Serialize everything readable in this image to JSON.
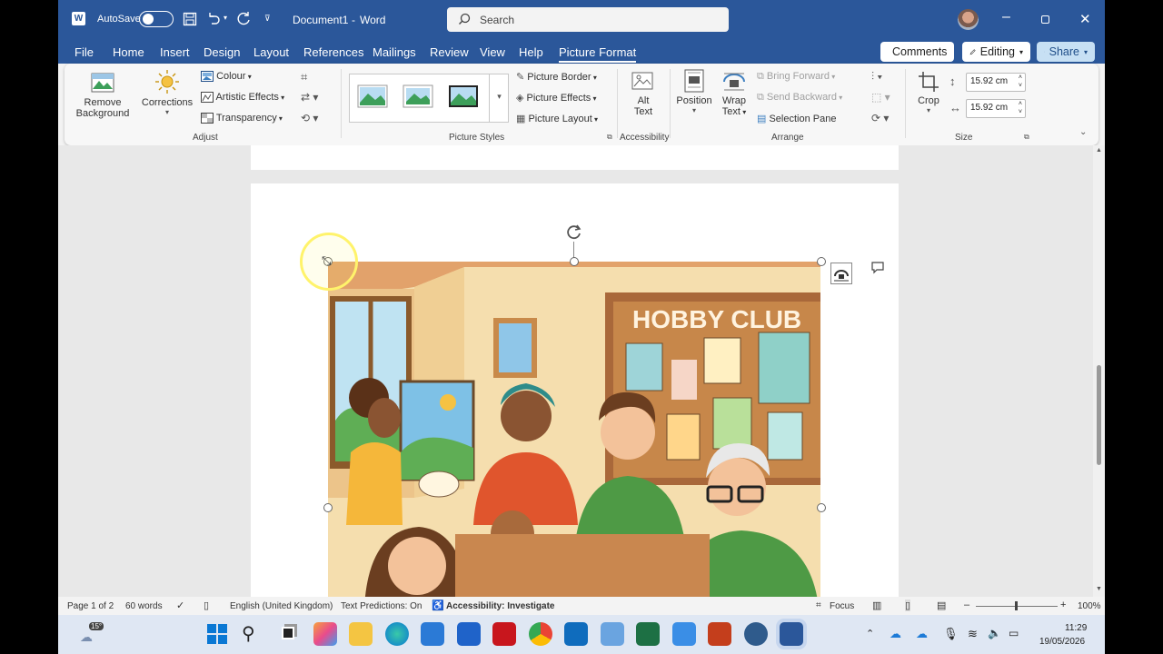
{
  "titlebar": {
    "autosave": "AutoSave",
    "doc_name": "Document1",
    "sep": "-",
    "app": "Word",
    "search_placeholder": "Search"
  },
  "tabs": [
    "File",
    "Home",
    "Insert",
    "Design",
    "Layout",
    "References",
    "Mailings",
    "Review",
    "View",
    "Help",
    "Picture Format"
  ],
  "actions": {
    "comments": "Comments",
    "editing": "Editing",
    "share": "Share"
  },
  "ribbon": {
    "adjust": {
      "remove_bg_1": "Remove",
      "remove_bg_2": "Background",
      "corrections": "Corrections",
      "colour": "Colour",
      "artistic": "Artistic Effects",
      "transparency": "Transparency",
      "group": "Adjust"
    },
    "styles": {
      "border": "Picture Border",
      "effects": "Picture Effects",
      "layout": "Picture Layout",
      "group": "Picture Styles"
    },
    "accessibility": {
      "alt_1": "Alt",
      "alt_2": "Text",
      "group": "Accessibility"
    },
    "arrange": {
      "position": "Position",
      "wrap_1": "Wrap",
      "wrap_2": "Text",
      "bring": "Bring Forward",
      "send": "Send Backward",
      "selection": "Selection Pane",
      "group": "Arrange"
    },
    "size": {
      "crop": "Crop",
      "height": "15.92 cm",
      "width": "15.92 cm",
      "group": "Size"
    }
  },
  "image": {
    "sign": "HOBBY CLUB"
  },
  "status": {
    "page": "Page 1 of 2",
    "words": "60 words",
    "language": "English (United Kingdom)",
    "predictions": "Text Predictions: On",
    "accessibility": "Accessibility: Investigate",
    "focus": "Focus",
    "zoom": "100%"
  },
  "taskbar": {
    "weather": "15°",
    "time": "11:29",
    "date": "19/05/2026"
  },
  "colors": {
    "word_blue": "#2b579a",
    "share_blue": "#c7e0f4",
    "highlight": "#fff36b"
  }
}
